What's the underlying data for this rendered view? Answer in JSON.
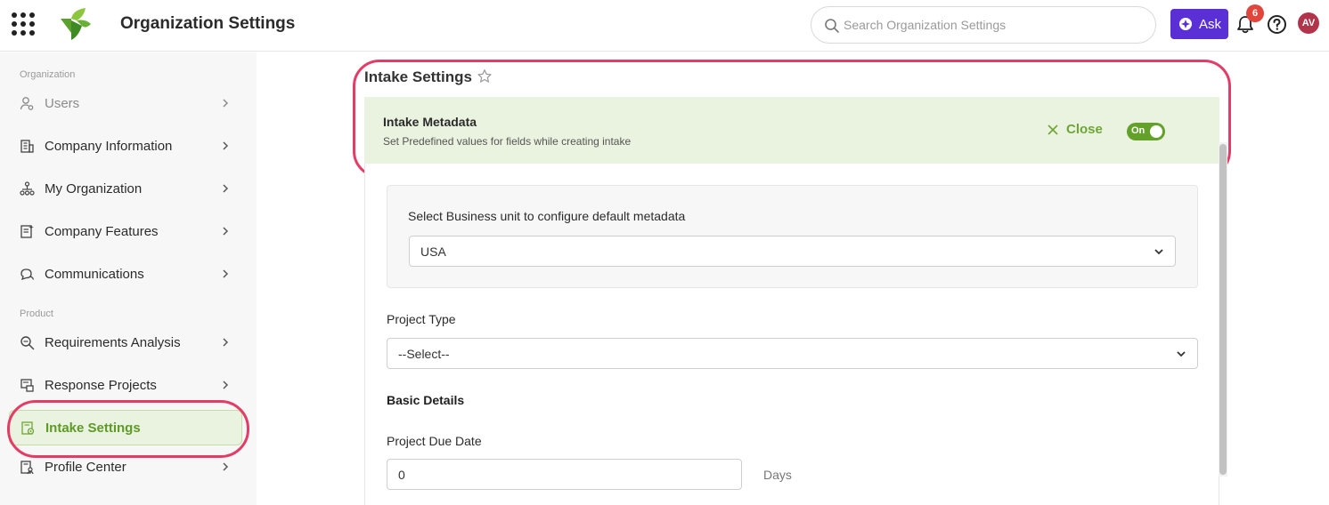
{
  "header": {
    "title": "Organization Settings",
    "search_placeholder": "Search Organization Settings",
    "ask_label": "Ask",
    "notification_count": "6",
    "avatar_initials": "AV"
  },
  "sidebar": {
    "sections": {
      "organization": "Organization",
      "product": "Product"
    },
    "items": [
      {
        "label": "Users",
        "icon": "users-icon"
      },
      {
        "label": "Company Information",
        "icon": "building-icon"
      },
      {
        "label": "My Organization",
        "icon": "org-chart-icon"
      },
      {
        "label": "Company Features",
        "icon": "features-icon"
      },
      {
        "label": "Communications",
        "icon": "chat-icon"
      },
      {
        "label": "Requirements Analysis",
        "icon": "magnify-icon"
      },
      {
        "label": "Response Projects",
        "icon": "projects-icon"
      },
      {
        "label": "Intake Settings",
        "icon": "intake-icon"
      },
      {
        "label": "Profile Center",
        "icon": "profile-icon"
      }
    ],
    "active_item": "Intake Settings"
  },
  "main": {
    "page_title": "Intake Settings",
    "banner": {
      "title": "Intake Metadata",
      "subtitle": "Set Predefined values for fields while creating intake",
      "close_label": "Close",
      "toggle_label": "On"
    },
    "business_unit": {
      "label": "Select Business unit to configure default metadata",
      "value": "USA"
    },
    "project_type": {
      "label": "Project Type",
      "value": "--Select--"
    },
    "basic_details_heading": "Basic Details",
    "project_due_date": {
      "label": "Project Due Date",
      "value": "0",
      "unit": "Days"
    }
  },
  "colors": {
    "brand_green": "#64a12b",
    "ask_purple": "#5b2fd6",
    "highlight": "#e23d66",
    "banner_bg": "#eaf3df"
  }
}
